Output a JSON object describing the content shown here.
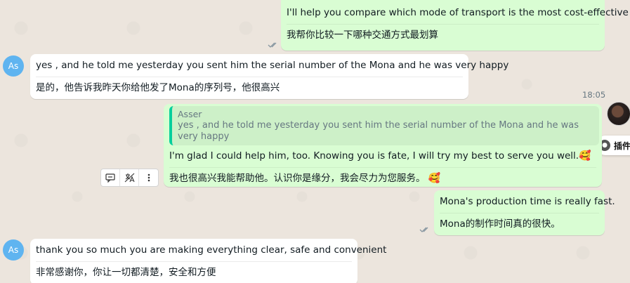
{
  "messages": {
    "m1": {
      "en": "I'll help you compare which mode of transport is the most cost-effective",
      "zh": "我帮你比较一下哪种交通方式最划算"
    },
    "m2": {
      "avatar": "As",
      "en": "yes , and he told me yesterday you sent him the serial number of the Mona and he was very happy",
      "zh": "是的，他告诉我昨天你给他发了Mona的序列号，他很高兴"
    },
    "time_1": "18:05",
    "m3": {
      "quote_name": "Asser",
      "quote_text": "yes , and he told me yesterday you sent him the serial number of the Mona and he was very happy",
      "en": "I'm glad I could help him, too. Knowing you is fate, I will try my best to serve you well.",
      "zh": "我也很高兴我能帮助他。认识你是缘分，我会尽力为您服务。",
      "emoji": "🥰"
    },
    "m4": {
      "en": "Mona's production time is really fast.",
      "zh": "Mona的制作时间真的很快。"
    },
    "m5": {
      "avatar": "As",
      "en": "thank you so much you are making everything clear, safe and convenient",
      "zh": "非常感谢你，你让一切都清楚，安全和方便"
    }
  },
  "plugin": {
    "label": "插件"
  },
  "toolbar": {
    "icons": [
      "comment-icon",
      "translate-off-icon",
      "more-vertical-icon"
    ]
  },
  "colors": {
    "outgoing_bubble": "#d9fdd3",
    "incoming_bubble": "#ffffff",
    "avatar": "#5fb4f0",
    "quote_accent": "#06cf9c",
    "background": "#ece5dd"
  }
}
